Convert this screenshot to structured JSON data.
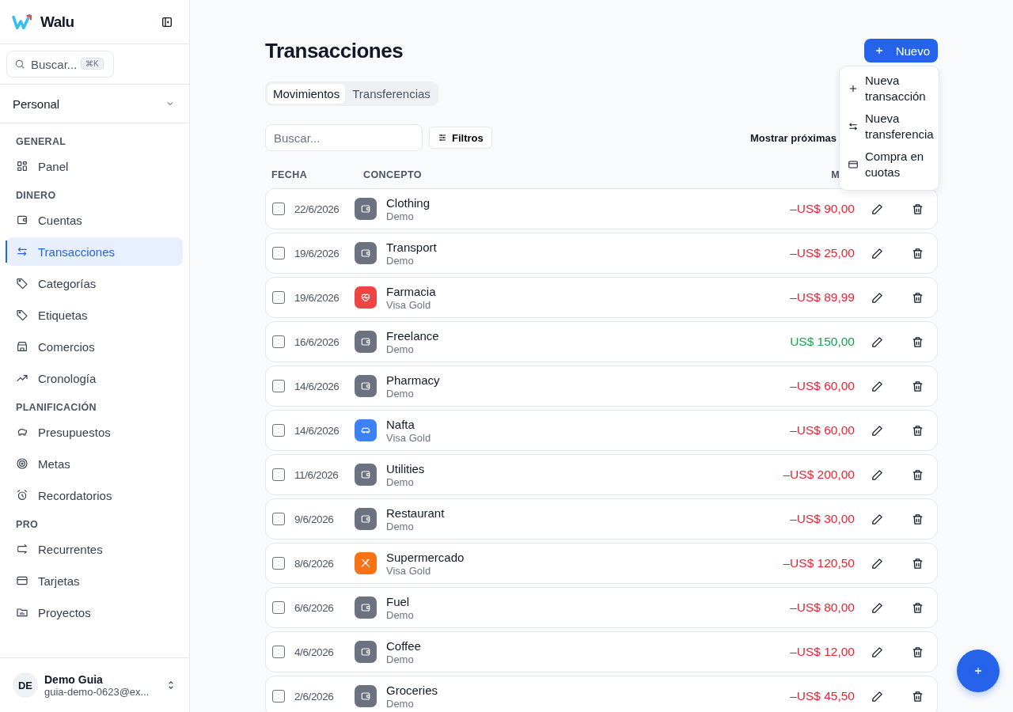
{
  "sidebar": {
    "brand": "Walu",
    "search": {
      "placeholder": "Buscar...",
      "shortcut": "⌘K"
    },
    "workspace": "Personal",
    "sections": [
      {
        "title": "GENERAL",
        "items": [
          {
            "label": "Panel",
            "kind": "grid",
            "selected": false
          }
        ]
      },
      {
        "title": "DINERO",
        "items": [
          {
            "label": "Cuentas",
            "kind": "wallet",
            "selected": false
          },
          {
            "label": "Transacciones",
            "kind": "arrows",
            "selected": true
          },
          {
            "label": "Categorías",
            "kind": "tag",
            "selected": false
          },
          {
            "label": "Etiquetas",
            "kind": "tag",
            "selected": false
          },
          {
            "label": "Comercios",
            "kind": "store",
            "selected": false
          },
          {
            "label": "Cronología",
            "kind": "trend",
            "selected": false
          }
        ]
      },
      {
        "title": "PLANIFICACIÓN",
        "items": [
          {
            "label": "Presupuestos",
            "kind": "piggy",
            "selected": false
          },
          {
            "label": "Metas",
            "kind": "target",
            "selected": false
          },
          {
            "label": "Recordatorios",
            "kind": "alarm",
            "selected": false
          }
        ]
      },
      {
        "title": "PRO",
        "items": [
          {
            "label": "Recurrentes",
            "kind": "repeat",
            "selected": false
          },
          {
            "label": "Tarjetas",
            "kind": "card",
            "selected": false
          },
          {
            "label": "Proyectos",
            "kind": "folder",
            "selected": false
          }
        ]
      }
    ],
    "user": {
      "initials": "DE",
      "name": "Demo Guia",
      "email": "guia-demo-0623@ex..."
    }
  },
  "page": {
    "title": "Transacciones",
    "new_button": "Nuevo",
    "tabs": [
      {
        "label": "Movimientos",
        "selected": true
      },
      {
        "label": "Transferencias",
        "selected": false
      }
    ],
    "search": {
      "placeholder": "Buscar..."
    },
    "filters_button": "Filtros",
    "show_upcoming": "Mostrar próximas",
    "menu": [
      {
        "label": "Nueva transacción",
        "kind": "plus"
      },
      {
        "label": "Nueva transferencia",
        "kind": "arrows"
      },
      {
        "label": "Compra en cuotas",
        "kind": "card"
      }
    ],
    "table": {
      "columns": [
        "FECHA",
        "CONCEPTO",
        "M"
      ],
      "rows": [
        {
          "date": "22/6/2026",
          "kind": "wallet",
          "color": "#6b7280",
          "concept": "Clothing",
          "account": "Demo",
          "amount": "–US$ 90,00",
          "positive": false,
          "checked": false
        },
        {
          "date": "19/6/2026",
          "kind": "wallet",
          "color": "#6b7280",
          "concept": "Transport",
          "account": "Demo",
          "amount": "–US$ 25,00",
          "positive": false,
          "checked": false
        },
        {
          "date": "19/6/2026",
          "kind": "heart",
          "color": "#ef4444",
          "concept": "Farmacia",
          "account": "Visa Gold",
          "amount": "–US$ 89,99",
          "positive": false,
          "checked": false
        },
        {
          "date": "16/6/2026",
          "kind": "wallet",
          "color": "#6b7280",
          "concept": "Freelance",
          "account": "Demo",
          "amount": "US$ 150,00",
          "positive": true,
          "checked": false
        },
        {
          "date": "14/6/2026",
          "kind": "wallet",
          "color": "#6b7280",
          "concept": "Pharmacy",
          "account": "Demo",
          "amount": "–US$ 60,00",
          "positive": false,
          "checked": false
        },
        {
          "date": "14/6/2026",
          "kind": "car",
          "color": "#3b82f6",
          "concept": "Nafta",
          "account": "Visa Gold",
          "amount": "–US$ 60,00",
          "positive": false,
          "checked": false
        },
        {
          "date": "11/6/2026",
          "kind": "wallet",
          "color": "#6b7280",
          "concept": "Utilities",
          "account": "Demo",
          "amount": "–US$ 200,00",
          "positive": false,
          "checked": false
        },
        {
          "date": "9/6/2026",
          "kind": "wallet",
          "color": "#6b7280",
          "concept": "Restaurant",
          "account": "Demo",
          "amount": "–US$ 30,00",
          "positive": false,
          "checked": false
        },
        {
          "date": "8/6/2026",
          "kind": "utensils",
          "color": "#f97316",
          "concept": "Supermercado",
          "account": "Visa Gold",
          "amount": "–US$ 120,50",
          "positive": false,
          "checked": false
        },
        {
          "date": "6/6/2026",
          "kind": "wallet",
          "color": "#6b7280",
          "concept": "Fuel",
          "account": "Demo",
          "amount": "–US$ 80,00",
          "positive": false,
          "checked": false
        },
        {
          "date": "4/6/2026",
          "kind": "wallet",
          "color": "#6b7280",
          "concept": "Coffee",
          "account": "Demo",
          "amount": "–US$ 12,00",
          "positive": false,
          "checked": false
        },
        {
          "date": "2/6/2026",
          "kind": "wallet",
          "color": "#6b7280",
          "concept": "Groceries",
          "account": "Demo",
          "amount": "–US$ 45,50",
          "positive": false,
          "checked": false
        }
      ]
    }
  }
}
